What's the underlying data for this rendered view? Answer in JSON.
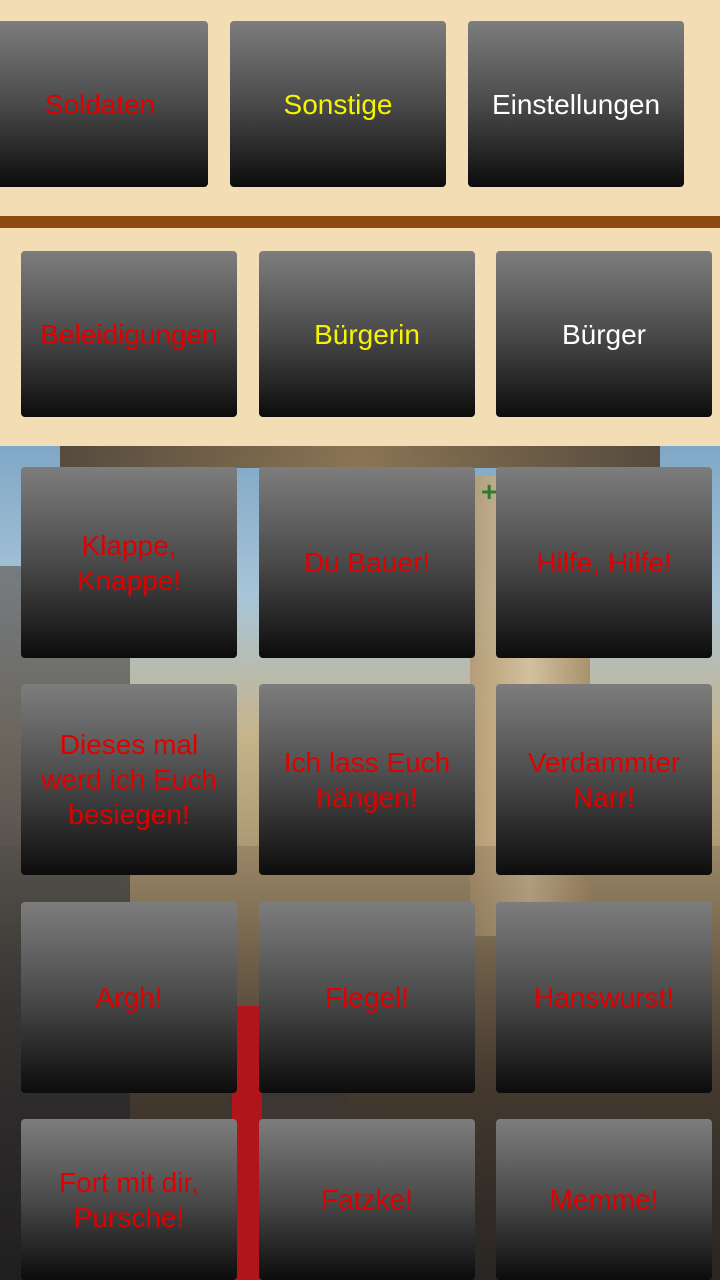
{
  "top_row": [
    {
      "label": "Soldaten",
      "color": "#e00000"
    },
    {
      "label": "Sonstige",
      "color": "#f5f500"
    },
    {
      "label": "Einstellungen",
      "color": "#ffffff"
    }
  ],
  "category_row": [
    {
      "label": "Beleidigungen",
      "color": "#e00000"
    },
    {
      "label": "Bürgerin",
      "color": "#f5f500"
    },
    {
      "label": "Bürger",
      "color": "#ffffff"
    }
  ],
  "sounds": [
    {
      "label": "Klappe, Knappe!"
    },
    {
      "label": "Du Bauer!"
    },
    {
      "label": "Hilfe, Hilfe!"
    },
    {
      "label": "Dieses mal werd ich Euch besiegen!"
    },
    {
      "label": "Ich lass Euch hängen!"
    },
    {
      "label": "Verdammter Narr!"
    },
    {
      "label": "Argh!"
    },
    {
      "label": "Flegel!"
    },
    {
      "label": "Hanswurst!"
    },
    {
      "label": "Fort mit dir, Pursche!"
    },
    {
      "label": "Fatzke!"
    },
    {
      "label": "Memme!"
    }
  ],
  "colors": {
    "background": "#f3ddb5",
    "divider": "#8e4a12",
    "sound_text": "#e00000"
  }
}
